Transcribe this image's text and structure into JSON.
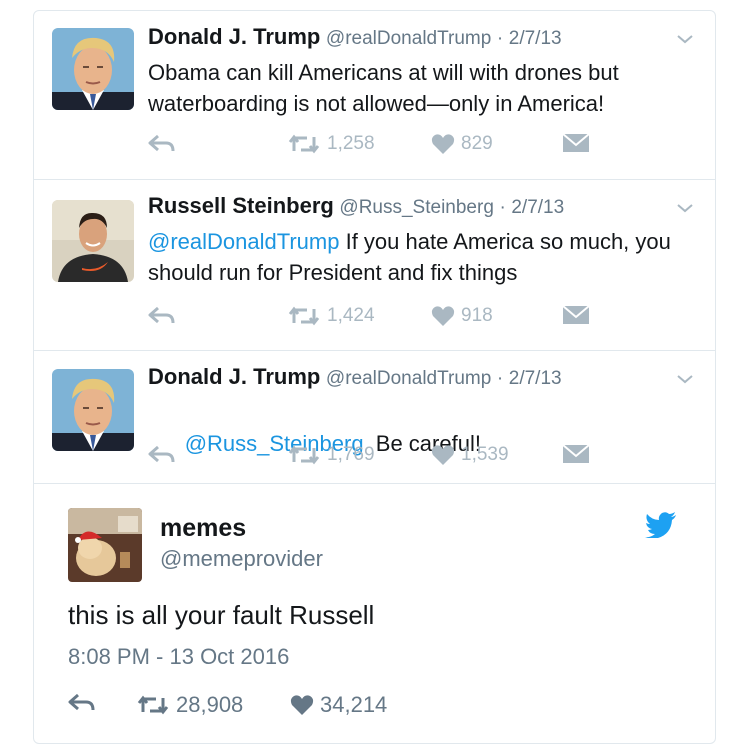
{
  "tweets": [
    {
      "name": "Donald J. Trump",
      "handle": "@realDonaldTrump",
      "separator": "·",
      "date": "2/7/13",
      "mention": "",
      "text": "Obama can kill Americans at will with drones but waterboarding is not allowed—only in America!",
      "retweets": "1,258",
      "likes": "829",
      "avatar": "trump-portrait"
    },
    {
      "name": "Russell Steinberg",
      "handle": "@Russ_Steinberg",
      "separator": "·",
      "date": "2/7/13",
      "mention": "@realDonaldTrump",
      "text": " If you hate America so much, you should run for President and fix things",
      "retweets": "1,424",
      "likes": "918",
      "avatar": "steinberg-portrait"
    },
    {
      "name": "Donald J. Trump",
      "handle": "@realDonaldTrump",
      "separator": "·",
      "date": "2/7/13",
      "mention": "@Russ_Steinberg",
      "text": "  Be careful!",
      "retweets": "1,769",
      "likes": "1,539",
      "avatar": "trump-portrait"
    }
  ],
  "quote": {
    "name": "memes",
    "handle": "@memeprovider",
    "text": "this is all your fault Russell",
    "timestamp": "8:08 PM - 13 Oct 2016",
    "retweets": "28,908",
    "likes": "34,214",
    "avatar": "dog-santa-hat"
  },
  "icons": {
    "reply": "reply-icon",
    "retweet": "retweet-icon",
    "like": "heart-icon",
    "message": "envelope-icon",
    "more": "chevron-down-icon",
    "brand": "twitter-bird-icon"
  },
  "colors": {
    "link": "#1b95e0",
    "action_gray": "#aab8c2",
    "meta_gray": "#657786",
    "twitter_blue": "#1da1f2",
    "border": "#e1e8ed"
  }
}
